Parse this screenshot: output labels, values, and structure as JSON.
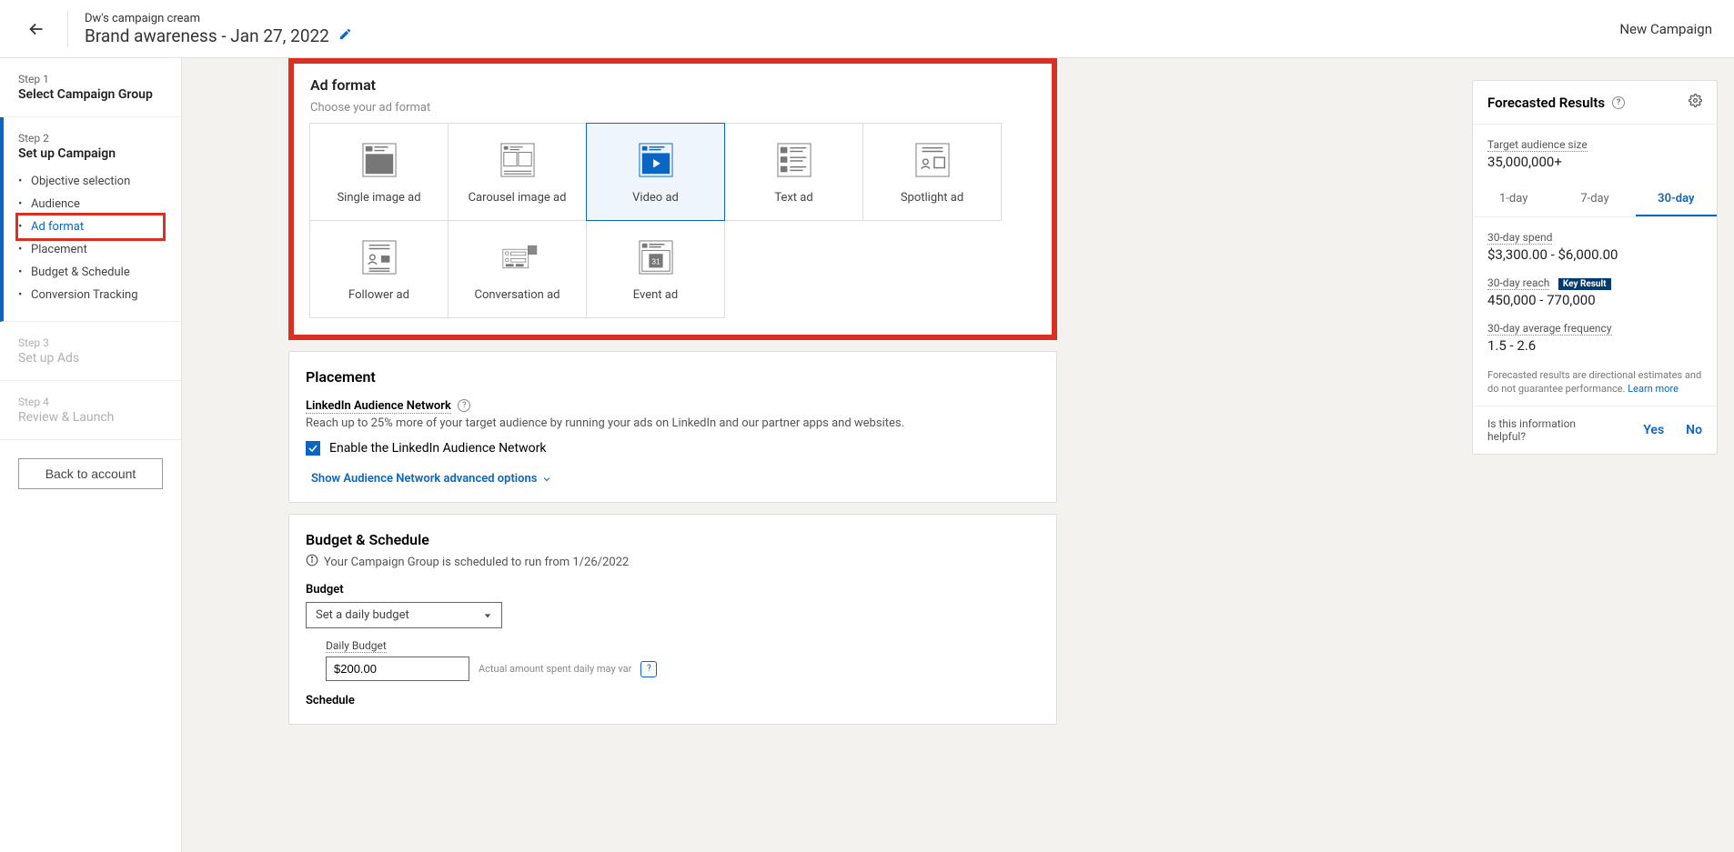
{
  "header": {
    "group_name": "Dw's campaign cream",
    "campaign_title": "Brand awareness - Jan 27, 2022",
    "right_label": "New Campaign"
  },
  "sidebar": {
    "step1_label": "Step 1",
    "step1_title": "Select Campaign Group",
    "step2_label": "Step 2",
    "step2_title": "Set up Campaign",
    "substeps": {
      "objective": "Objective selection",
      "audience": "Audience",
      "adformat": "Ad format",
      "placement": "Placement",
      "budget": "Budget & Schedule",
      "conversion": "Conversion Tracking"
    },
    "step3_label": "Step 3",
    "step3_title": "Set up Ads",
    "step4_label": "Step 4",
    "step4_title": "Review & Launch",
    "back_button": "Back to account"
  },
  "adformat": {
    "title": "Ad format",
    "subtitle": "Choose your ad format",
    "options": {
      "single": "Single image ad",
      "carousel": "Carousel image ad",
      "video": "Video ad",
      "text": "Text ad",
      "spotlight": "Spotlight ad",
      "follower": "Follower ad",
      "conversation": "Conversation ad",
      "event": "Event ad"
    }
  },
  "placement": {
    "title": "Placement",
    "network_label": "LinkedIn Audience Network",
    "network_desc": "Reach up to 25% more of your target audience by running your ads on LinkedIn and our partner apps and websites.",
    "checkbox_label": "Enable the LinkedIn Audience Network",
    "advanced_link": "Show Audience Network advanced options"
  },
  "budget": {
    "title": "Budget & Schedule",
    "info_text": "Your Campaign Group is scheduled to run from 1/26/2022",
    "budget_label": "Budget",
    "budget_select": "Set a daily budget",
    "daily_label": "Daily Budget",
    "daily_value": "$200.00",
    "daily_note": "Actual amount spent daily may var",
    "schedule_label": "Schedule"
  },
  "forecast": {
    "title": "Forecasted Results",
    "audience_label": "Target audience size",
    "audience_value": "35,000,000+",
    "tabs": {
      "d1": "1-day",
      "d7": "7-day",
      "d30": "30-day"
    },
    "spend_label": "30-day spend",
    "spend_value": "$3,300.00 - $6,000.00",
    "reach_label": "30-day reach",
    "key_result": "Key Result",
    "reach_value": "450,000 - 770,000",
    "freq_label": "30-day average frequency",
    "freq_value": "1.5 - 2.6",
    "note_text": "Forecasted results are directional estimates and do not guarantee performance.",
    "learn_more": "Learn more",
    "helpful_q": "Is this information helpful?",
    "yes": "Yes",
    "no": "No"
  }
}
